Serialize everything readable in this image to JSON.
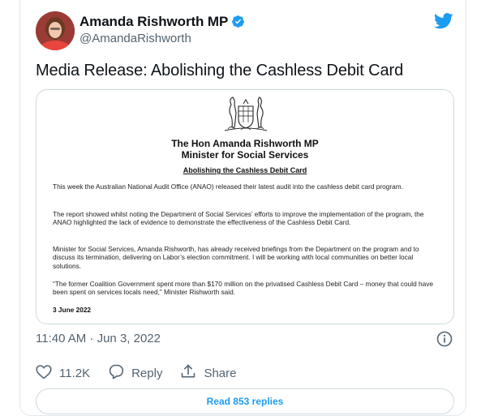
{
  "author": {
    "display_name": "Amanda Rishworth MP",
    "handle": "@AmandaRishworth",
    "verified": true
  },
  "tweet": {
    "text": "Media Release: Abolishing the Cashless Debit Card",
    "timestamp": "11:40 AM · Jun 3, 2022"
  },
  "media_document": {
    "title_line1": "The Hon Amanda Rishworth MP",
    "title_line2": "Minister for Social Services",
    "subheading": "Abolishing the Cashless Debit Card",
    "paragraphs": [
      "This week the Australian National Audit Office (ANAO) released their latest audit into the cashless debit card program.",
      "The report showed whilst noting the Department of Social Services’ efforts to improve the implementation of the program, the ANAO highlighted the lack of evidence to demonstrate the effectiveness of the Cashless Debit Card.",
      "Minister for Social Services, Amanda Rishworth, has already received briefings from the Department on the program and to discuss its termination, delivering on Labor’s election commitment. I will be working with local communities on better local solutions.",
      "“The former Coalition Government spent more than $170 million on the privatised Cashless Debit Card – money that could have been spent on services locals need,” Minister Rishworth said."
    ],
    "date": "3 June 2022"
  },
  "actions": {
    "likes": "11.2K",
    "reply_label": "Reply",
    "share_label": "Share"
  },
  "read_replies_label": "Read 853 replies",
  "colors": {
    "accent": "#1d9bf0",
    "text": "#0f1419",
    "secondary": "#536471",
    "border": "#cfd9de"
  },
  "icons": [
    "verified-badge-icon",
    "twitter-bird-icon",
    "info-icon",
    "heart-icon",
    "reply-icon",
    "share-icon",
    "coat-of-arms-icon"
  ]
}
